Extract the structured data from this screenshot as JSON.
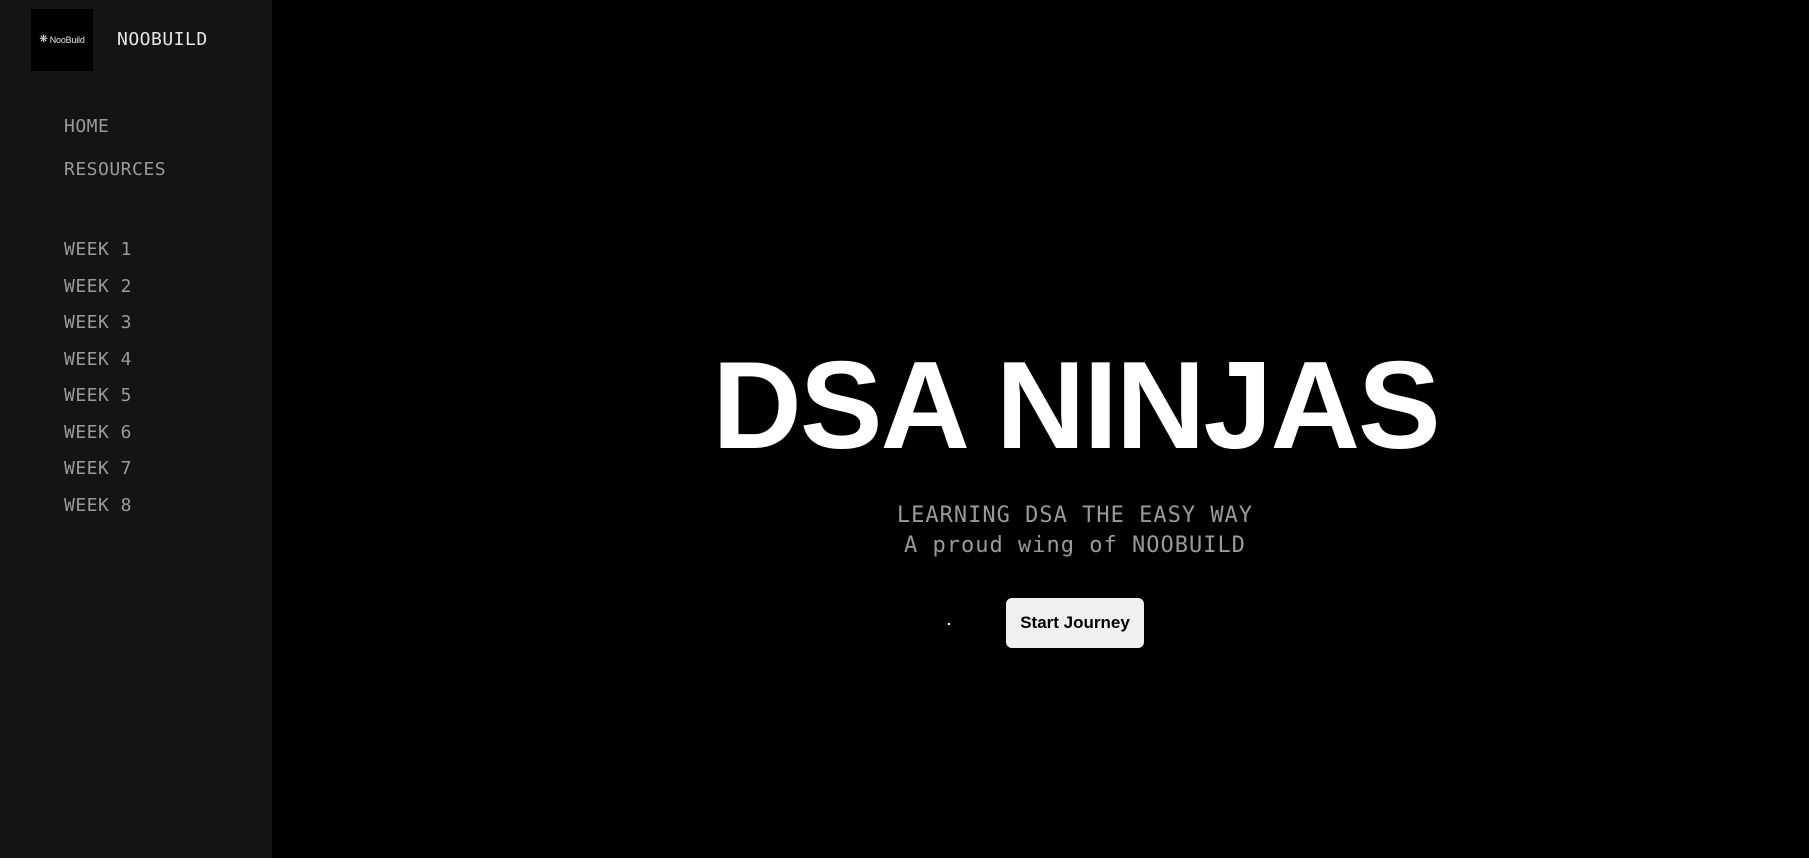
{
  "brand": {
    "logo_icon": "flower-asterisk-icon",
    "logo_text": "NooBuild",
    "name": "NOOBUILD"
  },
  "nav": {
    "main": [
      {
        "label": "HOME"
      },
      {
        "label": "RESOURCES"
      }
    ],
    "weeks": [
      {
        "label": "WEEK 1"
      },
      {
        "label": "WEEK 2"
      },
      {
        "label": "WEEK 3"
      },
      {
        "label": "WEEK 4"
      },
      {
        "label": "WEEK 5"
      },
      {
        "label": "WEEK 6"
      },
      {
        "label": "WEEK 7"
      },
      {
        "label": "WEEK 8"
      }
    ]
  },
  "hero": {
    "title": "DSA NINJAS",
    "subtitle_line1": "LEARNING DSA THE EASY WAY",
    "subtitle_line2": "A proud wing of NOOBUILD",
    "cta_label": "Start Journey"
  },
  "colors": {
    "page_background": "#000000",
    "sidebar_background": "#141414",
    "nav_text": "#9a9a9a",
    "title_text": "#ffffff",
    "button_background": "#f0f0f0"
  }
}
